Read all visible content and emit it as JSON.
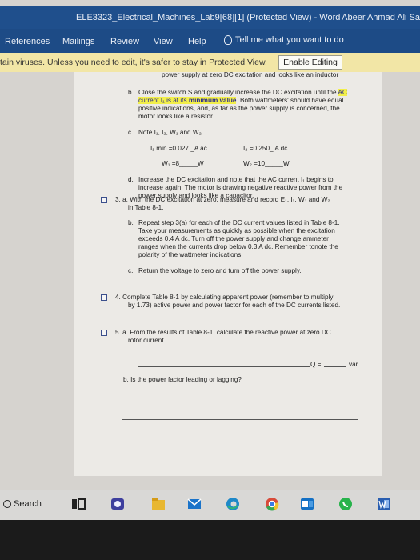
{
  "window": {
    "title": "ELE3323_Electrical_Machines_Lab9[68][1] (Protected View)  -  Word",
    "user": "Abeer Ahmad Ali Sa"
  },
  "ribbon": {
    "tabs": [
      "References",
      "Mailings",
      "Review",
      "View",
      "Help"
    ],
    "tell_me": "Tell me what you want to do"
  },
  "protected_view": {
    "message": "tain viruses. Unless you need to edit, it's safer to stay in Protected View.",
    "enable_button": "Enable Editing"
  },
  "document": {
    "top_line": "power supply at zero DC excitation and looks like an inductor",
    "b1": {
      "marker": "b",
      "line1_pre": "Close the switch S and gradually increase the DC excitation until the ",
      "line1_hl": "AC",
      "line2_hl": "current I₁ is at its ",
      "line2_hlb": "minimum value",
      "line2_post": ". Both wattmeters' should have equal",
      "line3": "positive indications, and, as far as the power supply is concerned, the",
      "line4": "motor looks like a resistor."
    },
    "c1": {
      "marker": "c.",
      "text": "Note I₁, I₂, W₁ and W₂",
      "i1": "I₁ min =0.027 _A ac",
      "i2": "I₂ =0.250_ A dc",
      "w1": "W₁ =8_____W",
      "w2": "W₂ =10_____W"
    },
    "d1": {
      "marker": "d.",
      "line1": "Increase the DC excitation and note that the AC current I₁ begins to",
      "line2": "increase again. The motor is drawing negative reactive power from the",
      "line3": "power supply and looks like a capacitor."
    },
    "s3": {
      "line1": "3.  a. With the DC excitation at zero, measure and record E₁, I₁, W₁ and W₂",
      "line2": "in Table 8-1.",
      "b_marker": "b.",
      "b_line1": "Repeat step 3(a) for each of the DC current values listed in Table 8-1.",
      "b_line2": "Take your measurements as quickly as possible when the excitation",
      "b_line3": "exceeds 0.4 A dc. Turn off the power supply and change ammeter",
      "b_line4": "ranges when the currents drop below 0.3 A dc. Remember tonote the",
      "b_line5": "polarity of the wattmeter              indications.",
      "c_marker": "c.",
      "c_line1": "Return the voltage to zero and turn off the power supply."
    },
    "s4": {
      "line1": "4.  Complete Table 8-1 by calculating apparent power (remember to multiply",
      "line2": "by 1.73) active power and power factor for each of the DC currents listed."
    },
    "s5": {
      "line1": "5.  a. From the results of Table 8-1, calculate the reactive power at zero DC",
      "line2": "rotor current.",
      "q_label": "Q =",
      "q_unit": "var",
      "b_line": "b.   Is the power factor leading or lagging?"
    }
  },
  "taskbar": {
    "search_label": "Search",
    "icons": [
      "task-view-icon",
      "teams-icon",
      "file-explorer-icon",
      "mail-icon",
      "edge-icon",
      "chrome-icon",
      "outlook-icon",
      "whatsapp-icon",
      "word-icon"
    ]
  },
  "colors": {
    "title_bar": "#1f4f8c",
    "ribbon": "#1d4b86",
    "protected_bar": "#f2e6a6",
    "highlight": "#f2ef4a"
  }
}
